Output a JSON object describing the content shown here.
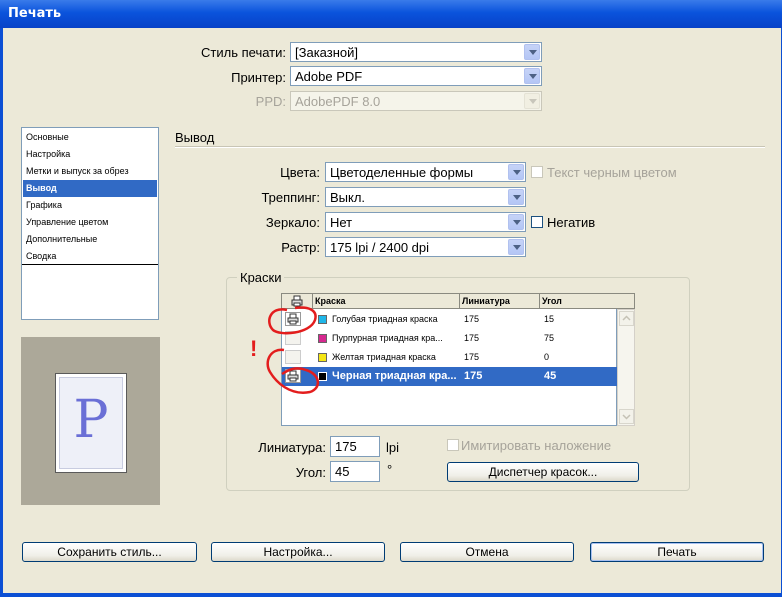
{
  "window": {
    "title": "Печать"
  },
  "top": {
    "style_label": "Стиль печати:",
    "style_value": "[Заказной]",
    "printer_label": "Принтер:",
    "printer_value": "Adobe PDF",
    "ppd_label": "PPD:",
    "ppd_value": "AdobePDF 8.0"
  },
  "sidebar": {
    "items": [
      {
        "label": "Основные"
      },
      {
        "label": "Настройка"
      },
      {
        "label": "Метки и выпуск за обрез"
      },
      {
        "label": "Вывод"
      },
      {
        "label": "Графика"
      },
      {
        "label": "Управление цветом"
      },
      {
        "label": "Дополнительные"
      },
      {
        "label": "Сводка"
      }
    ],
    "selected_index": 3
  },
  "preview": {
    "letter": "P"
  },
  "section": {
    "title": "Вывод"
  },
  "output": {
    "colors_label": "Цвета:",
    "colors_value": "Цветоделенные формы",
    "text_black_label": "Текст черным цветом",
    "trapping_label": "Треппинг:",
    "trapping_value": "Выкл.",
    "mirror_label": "Зеркало:",
    "mirror_value": "Нет",
    "negative_label": "Негатив",
    "raster_label": "Растр:",
    "raster_value": "175 lpi / 2400 dpi"
  },
  "inks": {
    "group_label": "Краски",
    "headers": {
      "ink": "Краска",
      "lineature": "Линиатура",
      "angle": "Угол"
    },
    "rows": [
      {
        "name": "Голубая триадная краска",
        "lineature": "175",
        "angle": "15",
        "color": "#1fb6e8",
        "printer_icon": true
      },
      {
        "name": "Пурпурная триадная кра...",
        "lineature": "175",
        "angle": "75",
        "color": "#d6288f",
        "printer_icon": false
      },
      {
        "name": "Желтая триадная краска",
        "lineature": "175",
        "angle": "0",
        "color": "#f5e614",
        "printer_icon": false
      },
      {
        "name": "Черная триадная кра...",
        "lineature": "175",
        "angle": "45",
        "color": "#000000",
        "printer_icon": true
      }
    ],
    "selected_row": 3,
    "annotation_mark": "!",
    "lineature_label": "Линиатура:",
    "lineature_value": "175",
    "lineature_unit": "lpi",
    "angle_label": "Угол:",
    "angle_value": "45",
    "angle_unit": "°",
    "simulate_label": "Имитировать наложение",
    "ink_manager_button": "Диспетчер красок..."
  },
  "footer": {
    "save_style": "Сохранить стиль...",
    "setup": "Настройка...",
    "cancel": "Отмена",
    "print": "Печать"
  }
}
